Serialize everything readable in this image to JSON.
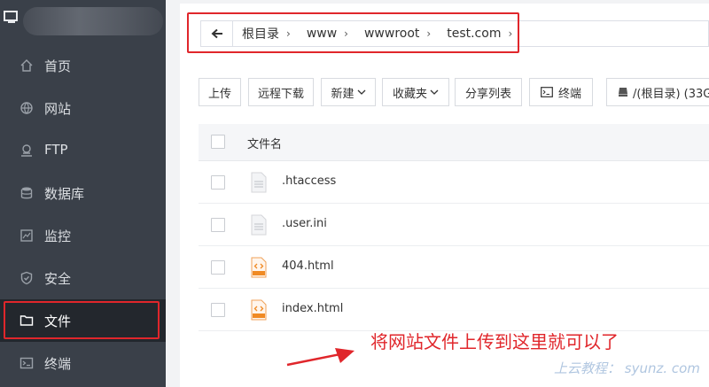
{
  "sidebar": {
    "items": [
      {
        "label": "首页",
        "icon": "home-icon"
      },
      {
        "label": "网站",
        "icon": "globe-icon"
      },
      {
        "label": "FTP",
        "icon": "ftp-icon"
      },
      {
        "label": "数据库",
        "icon": "database-icon"
      },
      {
        "label": "监控",
        "icon": "monitor-icon"
      },
      {
        "label": "安全",
        "icon": "shield-icon"
      },
      {
        "label": "文件",
        "icon": "folder-icon",
        "active": true
      },
      {
        "label": "终端",
        "icon": "terminal-icon"
      }
    ]
  },
  "breadcrumb": {
    "segments": [
      "根目录",
      "www",
      "wwwroot",
      "test.com"
    ],
    "separator": "›"
  },
  "toolbar": {
    "upload": "上传",
    "remote_download": "远程下载",
    "new": "新建",
    "favorites": "收藏夹",
    "share_list": "分享列表",
    "terminal": "终端",
    "disk": "/(根目录) (33G"
  },
  "table": {
    "header_name": "文件名",
    "rows": [
      {
        "name": ".htaccess",
        "type": "text"
      },
      {
        "name": ".user.ini",
        "type": "text"
      },
      {
        "name": "404.html",
        "type": "html"
      },
      {
        "name": "index.html",
        "type": "html"
      }
    ]
  },
  "annotation": {
    "text": "将网站文件上传到这里就可以了",
    "color": "#e0262b"
  },
  "watermark": "上云教程： syunz. com",
  "colors": {
    "sidebar_bg": "#3a4049",
    "sidebar_active": "#23272d",
    "highlight_red": "#e0262b",
    "html_icon_orange": "#f08a24"
  }
}
